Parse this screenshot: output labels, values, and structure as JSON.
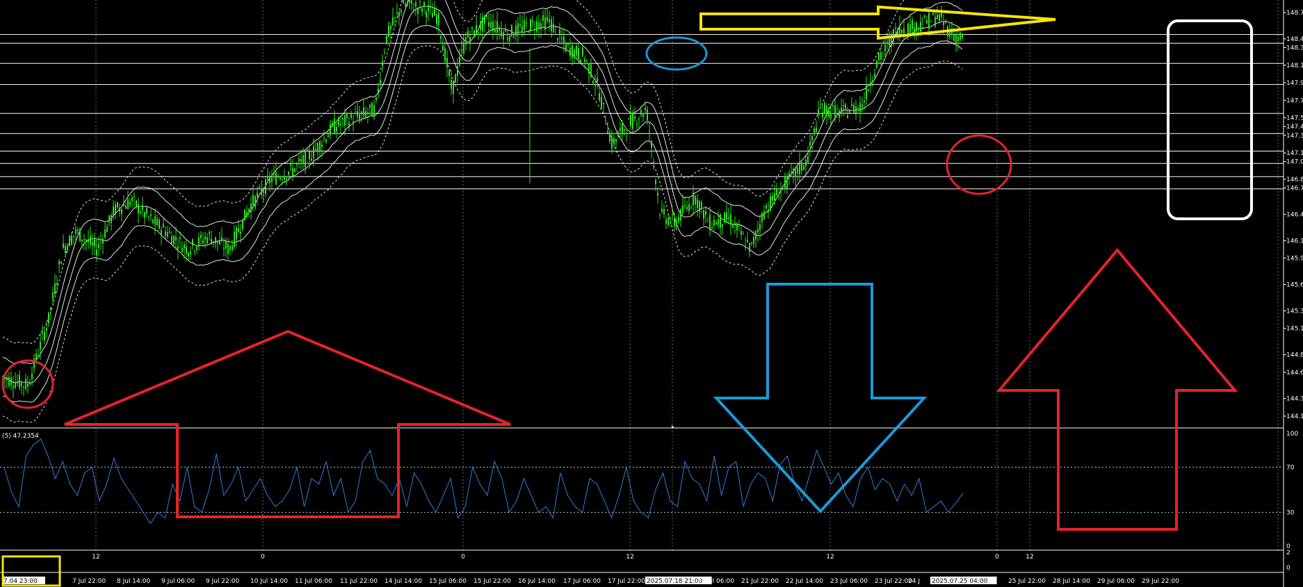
{
  "colors": {
    "background": "#000000",
    "candle": "#2ee31f",
    "bands": "#ffffff",
    "rsi": "#2f7fdc",
    "red_annotation": "#e8222a",
    "blue_annotation": "#1a9ad9",
    "yellow_annotation": "#f5e40a",
    "white_annotation": "#ffffff"
  },
  "indicator_label": "(5) 47.2354",
  "highlighted_first_date": "7.04 23:00",
  "chart_data": [
    {
      "type": "candlestick",
      "title": "",
      "price_ticks": [
        "148.7",
        "148.4",
        "148.3",
        "148.1",
        "147.9",
        "147.7",
        "147.5",
        "147.4",
        "147.3",
        "147.1",
        "147.0",
        "146.8",
        "146.7",
        "146.4",
        "146.1",
        "145.9",
        "145.6",
        "145.3",
        "145.1",
        "144.8",
        "144.6",
        "144.3",
        "144.1"
      ],
      "horizontal_levels": [
        148.45,
        148.35,
        148.12,
        147.88,
        147.55,
        147.32,
        147.12,
        146.98,
        146.83,
        146.69
      ],
      "ylim": [
        144.1,
        148.7
      ],
      "price_path": [
        [
          0,
          144.55
        ],
        [
          40,
          144.45
        ],
        [
          70,
          145.2
        ],
        [
          90,
          146.0
        ],
        [
          110,
          146.2
        ],
        [
          140,
          146.0
        ],
        [
          165,
          146.45
        ],
        [
          190,
          146.55
        ],
        [
          215,
          146.35
        ],
        [
          240,
          146.2
        ],
        [
          270,
          146.0
        ],
        [
          300,
          146.15
        ],
        [
          330,
          146.0
        ],
        [
          360,
          146.5
        ],
        [
          390,
          146.8
        ],
        [
          420,
          146.9
        ],
        [
          450,
          147.1
        ],
        [
          480,
          147.4
        ],
        [
          510,
          147.5
        ],
        [
          540,
          147.6
        ],
        [
          555,
          148.4
        ],
        [
          580,
          148.8
        ],
        [
          610,
          148.75
        ],
        [
          630,
          148.65
        ],
        [
          650,
          147.8
        ],
        [
          670,
          148.4
        ],
        [
          700,
          148.6
        ],
        [
          730,
          148.45
        ],
        [
          760,
          148.55
        ],
        [
          790,
          148.6
        ],
        [
          815,
          148.3
        ],
        [
          840,
          148.2
        ],
        [
          860,
          147.85
        ],
        [
          880,
          147.2
        ],
        [
          900,
          147.4
        ],
        [
          930,
          147.6
        ],
        [
          950,
          146.4
        ],
        [
          970,
          146.3
        ],
        [
          1000,
          146.6
        ],
        [
          1020,
          146.3
        ],
        [
          1050,
          146.35
        ],
        [
          1080,
          146.0
        ],
        [
          1100,
          146.45
        ],
        [
          1130,
          146.75
        ],
        [
          1160,
          147.0
        ],
        [
          1180,
          147.6
        ],
        [
          1210,
          147.55
        ],
        [
          1240,
          147.65
        ],
        [
          1260,
          148.1
        ],
        [
          1290,
          148.5
        ],
        [
          1320,
          148.55
        ],
        [
          1350,
          148.65
        ],
        [
          1370,
          148.45
        ],
        [
          1385,
          148.4
        ]
      ],
      "rsi_ticks": [
        "100",
        "70",
        "30",
        "0"
      ],
      "rsi_ylim": [
        0,
        100
      ],
      "rsi_levels": [
        70,
        30
      ],
      "rsi_values": [
        70,
        48,
        35,
        80,
        90,
        95,
        80,
        60,
        75,
        55,
        45,
        65,
        70,
        40,
        55,
        78,
        60,
        50,
        40,
        30,
        20,
        30,
        25,
        55,
        40,
        70,
        35,
        30,
        50,
        82,
        45,
        55,
        70,
        40,
        50,
        60,
        45,
        35,
        40,
        50,
        70,
        35,
        60,
        55,
        75,
        45,
        60,
        30,
        40,
        75,
        85,
        60,
        55,
        45,
        60,
        35,
        65,
        55,
        40,
        30,
        45,
        60,
        25,
        35,
        70,
        55,
        45,
        75,
        60,
        30,
        40,
        60,
        45,
        30,
        35,
        25,
        65,
        45,
        35,
        30,
        60,
        55,
        40,
        25,
        45,
        70,
        40,
        30,
        25,
        50,
        65,
        40,
        35,
        75,
        60,
        55,
        40,
        80,
        45,
        70,
        75,
        35,
        55,
        65,
        60,
        40,
        72,
        80,
        55,
        40,
        62,
        85,
        70,
        55,
        65,
        45,
        35,
        60,
        70,
        50,
        60,
        55,
        40,
        55,
        45,
        60,
        30,
        35,
        40,
        30,
        38,
        47
      ],
      "x_ticks": [
        "7.04 23:00",
        "7 Jul 22:00",
        "8 Jul 14:00",
        "9 Jul 06:00",
        "9 Jul 22:00",
        "10 Jul 14:00",
        "11 Jul 06:00",
        "11 Jul 22:00",
        "14 Jul 14:00",
        "15 Jul 06:00",
        "15 Jul 22:00",
        "16 Jul 14:00",
        "17 Jul 06:00",
        "17 Jul 22:00",
        "2025.07.18 21:00",
        "21 Jul 06:00",
        "21 Jul 22:00",
        "22 Jul 14:00",
        "23 Jul 06:00",
        "23 Jul 22:00",
        "24 J",
        "2025.07.25 04:00",
        "25 Jul 22:00",
        "28 Jul 14:00",
        "29 Jul 06:00",
        "29 Jul 22:00"
      ],
      "upper_markers": [
        "12",
        "0",
        "0",
        "12",
        "12",
        "0",
        "12"
      ],
      "lower_panel_ticks": [
        "2",
        "0"
      ]
    }
  ]
}
